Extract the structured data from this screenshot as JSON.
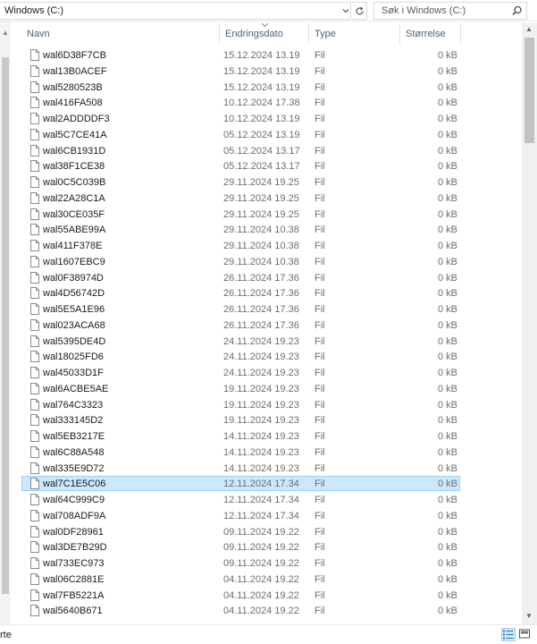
{
  "address": {
    "path": "Windows (C:)"
  },
  "search": {
    "placeholder": "Søk i Windows (C:)"
  },
  "columns": {
    "name": "Navn",
    "date": "Endringsdato",
    "type": "Type",
    "size": "Størrelse"
  },
  "files": [
    {
      "name": "wal6D38F7CB",
      "date": "15.12.2024 13.19",
      "type": "Fil",
      "size": "0 kB"
    },
    {
      "name": "wal13B0ACEF",
      "date": "15.12.2024 13.19",
      "type": "Fil",
      "size": "0 kB"
    },
    {
      "name": "wal5280523B",
      "date": "15.12.2024 13.19",
      "type": "Fil",
      "size": "0 kB"
    },
    {
      "name": "wal416FA508",
      "date": "10.12.2024 17.38",
      "type": "Fil",
      "size": "0 kB"
    },
    {
      "name": "wal2ADDDDF3",
      "date": "10.12.2024 13.19",
      "type": "Fil",
      "size": "0 kB"
    },
    {
      "name": "wal5C7CE41A",
      "date": "05.12.2024 13.19",
      "type": "Fil",
      "size": "0 kB"
    },
    {
      "name": "wal6CB1931D",
      "date": "05.12.2024 13.17",
      "type": "Fil",
      "size": "0 kB"
    },
    {
      "name": "wal38F1CE38",
      "date": "05.12.2024 13.17",
      "type": "Fil",
      "size": "0 kB"
    },
    {
      "name": "wal0C5C039B",
      "date": "29.11.2024 19.25",
      "type": "Fil",
      "size": "0 kB"
    },
    {
      "name": "wal22A28C1A",
      "date": "29.11.2024 19.25",
      "type": "Fil",
      "size": "0 kB"
    },
    {
      "name": "wal30CE035F",
      "date": "29.11.2024 19.25",
      "type": "Fil",
      "size": "0 kB"
    },
    {
      "name": "wal55ABE99A",
      "date": "29.11.2024 10.38",
      "type": "Fil",
      "size": "0 kB"
    },
    {
      "name": "wal411F378E",
      "date": "29.11.2024 10.38",
      "type": "Fil",
      "size": "0 kB"
    },
    {
      "name": "wal1607EBC9",
      "date": "29.11.2024 10.38",
      "type": "Fil",
      "size": "0 kB"
    },
    {
      "name": "wal0F38974D",
      "date": "26.11.2024 17.36",
      "type": "Fil",
      "size": "0 kB"
    },
    {
      "name": "wal4D56742D",
      "date": "26.11.2024 17.36",
      "type": "Fil",
      "size": "0 kB"
    },
    {
      "name": "wal5E5A1E96",
      "date": "26.11.2024 17.36",
      "type": "Fil",
      "size": "0 kB"
    },
    {
      "name": "wal023ACA68",
      "date": "26.11.2024 17.36",
      "type": "Fil",
      "size": "0 kB"
    },
    {
      "name": "wal5395DE4D",
      "date": "24.11.2024 19.23",
      "type": "Fil",
      "size": "0 kB"
    },
    {
      "name": "wal18025FD6",
      "date": "24.11.2024 19.23",
      "type": "Fil",
      "size": "0 kB"
    },
    {
      "name": "wal45033D1F",
      "date": "24.11.2024 19.23",
      "type": "Fil",
      "size": "0 kB"
    },
    {
      "name": "wal6ACBE5AE",
      "date": "19.11.2024 19.23",
      "type": "Fil",
      "size": "0 kB"
    },
    {
      "name": "wal764C3323",
      "date": "19.11.2024 19.23",
      "type": "Fil",
      "size": "0 kB"
    },
    {
      "name": "wal333145D2",
      "date": "19.11.2024 19.23",
      "type": "Fil",
      "size": "0 kB"
    },
    {
      "name": "wal5EB3217E",
      "date": "14.11.2024 19.23",
      "type": "Fil",
      "size": "0 kB"
    },
    {
      "name": "wal6C88A548",
      "date": "14.11.2024 19.23",
      "type": "Fil",
      "size": "0 kB"
    },
    {
      "name": "wal335E9D72",
      "date": "14.11.2024 19.23",
      "type": "Fil",
      "size": "0 kB"
    },
    {
      "name": "wal7C1E5C06",
      "date": "12.11.2024 17.34",
      "type": "Fil",
      "size": "0 kB",
      "selected": true
    },
    {
      "name": "wal64C999C9",
      "date": "12.11.2024 17.34",
      "type": "Fil",
      "size": "0 kB"
    },
    {
      "name": "wal708ADF9A",
      "date": "12.11.2024 17.34",
      "type": "Fil",
      "size": "0 kB"
    },
    {
      "name": "wal0DF28961",
      "date": "09.11.2024 19.22",
      "type": "Fil",
      "size": "0 kB"
    },
    {
      "name": "wal3DE7B29D",
      "date": "09.11.2024 19.22",
      "type": "Fil",
      "size": "0 kB"
    },
    {
      "name": "wal733EC973",
      "date": "09.11.2024 19.22",
      "type": "Fil",
      "size": "0 kB"
    },
    {
      "name": "wal06C2881E",
      "date": "04.11.2024 19.22",
      "type": "Fil",
      "size": "0 kB"
    },
    {
      "name": "wal7FB5221A",
      "date": "04.11.2024 19.22",
      "type": "Fil",
      "size": "0 kB"
    },
    {
      "name": "wal5640B671",
      "date": "04.11.2024 19.22",
      "type": "Fil",
      "size": "0 kB"
    }
  ],
  "status": {
    "text": "rte"
  },
  "colors": {
    "selected_bg": "#cce8ff",
    "selected_border": "#99d1ff",
    "header_text": "#4c607a"
  }
}
